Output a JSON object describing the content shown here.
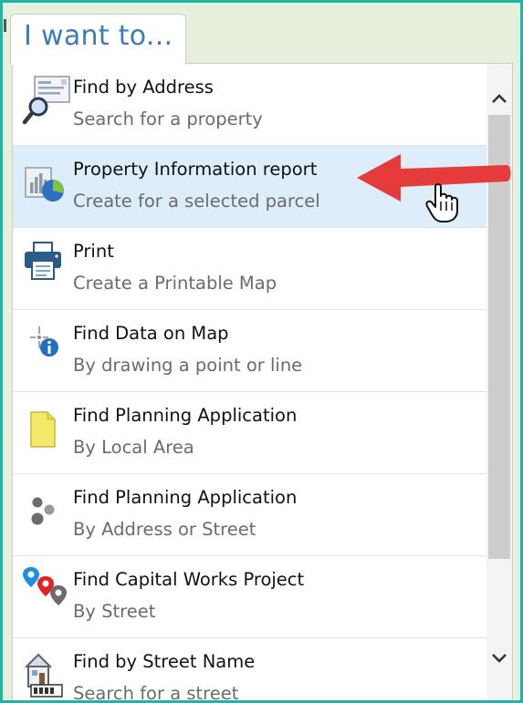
{
  "header": {
    "title": "I want to..."
  },
  "items": [
    {
      "title": "Find by Address",
      "subtitle": "Search for a property",
      "icon": "search-address-icon",
      "selected": false
    },
    {
      "title": "Property Information report",
      "subtitle": "Create for a selected parcel",
      "icon": "report-chart-icon",
      "selected": true
    },
    {
      "title": "Print",
      "subtitle": "Create a Printable Map",
      "icon": "printer-icon",
      "selected": false
    },
    {
      "title": "Find Data on Map",
      "subtitle": "By drawing a point or line",
      "icon": "identify-info-icon",
      "selected": false
    },
    {
      "title": "Find Planning Application",
      "subtitle": "By Local Area",
      "icon": "area-polygon-icon",
      "selected": false
    },
    {
      "title": "Find Planning Application",
      "subtitle": "By Address or Street",
      "icon": "dots-cluster-icon",
      "selected": false
    },
    {
      "title": "Find Capital Works Project",
      "subtitle": "By Street",
      "icon": "map-pins-icon",
      "selected": false
    },
    {
      "title": "Find by Street Name",
      "subtitle": "Search for a street",
      "icon": "house-street-icon",
      "selected": false
    }
  ],
  "colors": {
    "accent": "#3b7bbf",
    "selected_bg": "#ddeefa",
    "arrow": "#e63b3b",
    "frame": "#1fb5a6"
  }
}
